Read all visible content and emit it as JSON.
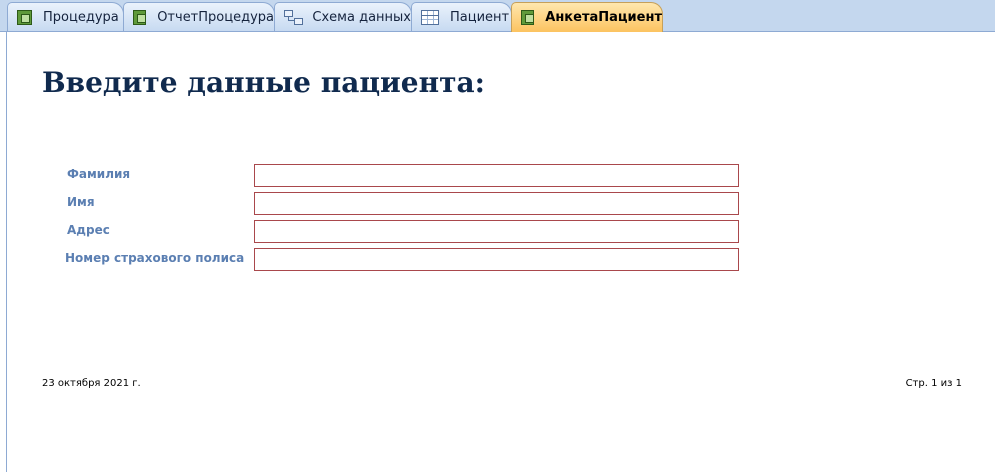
{
  "tabs": [
    {
      "label": "Процедура",
      "icon": "form-icon",
      "active": false
    },
    {
      "label": "ОтчетПроцедура",
      "icon": "form-icon",
      "active": false
    },
    {
      "label": "Схема данных",
      "icon": "relationships-icon",
      "active": false
    },
    {
      "label": "Пациент",
      "icon": "table-icon",
      "active": false
    },
    {
      "label": "АнкетаПациент",
      "icon": "form-icon",
      "active": true
    }
  ],
  "form": {
    "title": "Введите данные пациента:",
    "fields": [
      {
        "label": "Фамилия",
        "value": ""
      },
      {
        "label": "Имя",
        "value": ""
      },
      {
        "label": "Адрес",
        "value": ""
      },
      {
        "label": "Номер страхового полиса",
        "value": ""
      }
    ]
  },
  "footer": {
    "date": "23 октября 2021 г.",
    "page": "Стр. 1 из 1"
  },
  "colors": {
    "title": "#102a4e",
    "label": "#5b7fb2",
    "input_border": "#a9484c",
    "active_tab": "#fcc360"
  }
}
